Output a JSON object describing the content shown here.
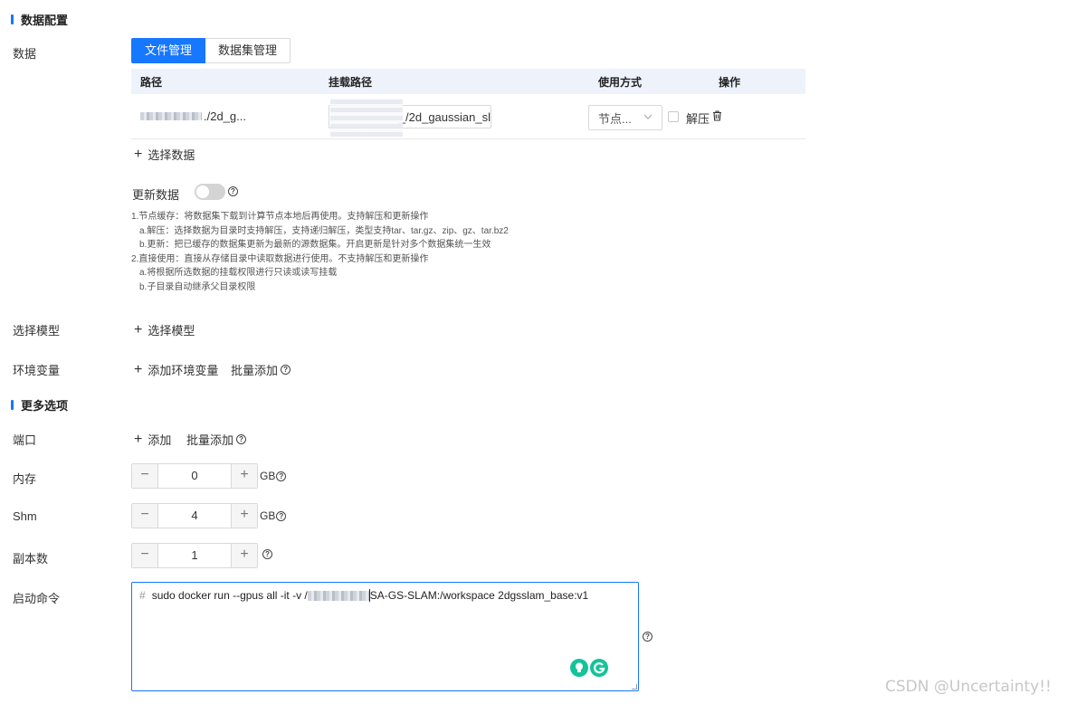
{
  "sections": {
    "data_config": "数据配置",
    "more_options": "更多选项"
  },
  "labels": {
    "data": "数据",
    "select_model": "选择模型",
    "env_vars": "环境变量",
    "port": "端口",
    "memory": "内存",
    "shm": "Shm",
    "replicas": "副本数",
    "startup_cmd": "启动命令"
  },
  "data_tabs": [
    "文件管理",
    "数据集管理"
  ],
  "table": {
    "headers": {
      "path": "路径",
      "mount_path": "挂载路径",
      "usage": "使用方式",
      "action": "操作"
    },
    "rows": [
      {
        "path_suffix": "./2d_g...",
        "mount_suffix": "_/2d_gaussian_sl",
        "usage": "节点...",
        "checkbox_label": "解压"
      }
    ]
  },
  "links": {
    "select_data": "选择数据",
    "select_model": "选择模型",
    "add_env": "添加环境变量",
    "batch_add": "批量添加",
    "add": "添加"
  },
  "update_data_label": "更新数据",
  "notes": [
    "1.节点缓存：将数据集下载到计算节点本地后再使用。支持解压和更新操作",
    "a.解压：选择数据为目录时支持解压，支持递归解压，类型支持tar、tar.gz、zip、gz、tar.bz2",
    "b.更新：把已缓存的数据集更新为最新的源数据集。开启更新是针对多个数据集统一生效",
    "2.直接使用：直接从存储目录中读取数据进行使用。不支持解压和更新操作",
    "a.将根据所选数据的挂载权限进行只读或读写挂载",
    "b.子目录自动继承父目录权限"
  ],
  "steppers": {
    "memory": {
      "value": "0",
      "unit": "GB"
    },
    "shm": {
      "value": "4",
      "unit": "GB"
    },
    "replicas": {
      "value": "1"
    }
  },
  "command": {
    "hash": "#",
    "prefix": "sudo docker run --gpus all -it -v /",
    "suffix": "SA-GS-SLAM:/workspace 2dgsslam_base:v1"
  },
  "watermark": "CSDN @Uncertainty!!",
  "colors": {
    "accent": "#1677ff",
    "table_header": "#eef2fb",
    "grammarly": "#15c39a"
  },
  "icons": [
    "trash-icon",
    "help-icon",
    "plus-icon",
    "chevron-down-icon",
    "grammarly-icon"
  ]
}
